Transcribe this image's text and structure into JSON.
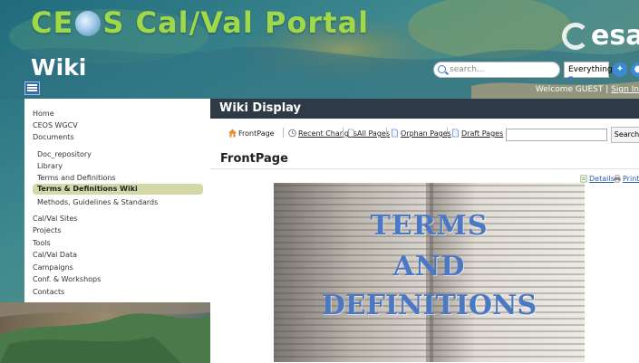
{
  "header": {
    "logo_prefix": "CE",
    "logo_suffix": "S Cal/Val Portal",
    "section_title": "Wiki",
    "partner_logo": "esa",
    "search": {
      "placeholder": "search...",
      "scope": "Everything"
    },
    "social_icons": [
      "twitter-icon",
      "social-icon"
    ],
    "welcome_text": "Welcome GUEST |",
    "sign_in": "Sign In"
  },
  "sidebar": {
    "items": [
      {
        "label": "Home"
      },
      {
        "label": "CEOS WGCV"
      },
      {
        "label": "Documents"
      },
      {
        "label": "Doc_repository"
      },
      {
        "label": "Library"
      },
      {
        "label": "Terms and Definitions"
      },
      {
        "label": "Terms & Definitions Wiki",
        "active": true
      },
      {
        "label": "Methods, Guidelines & Standards"
      },
      {
        "label": "Cal/Val Sites"
      },
      {
        "label": "Projects"
      },
      {
        "label": "Tools"
      },
      {
        "label": "Cal/Val Data"
      },
      {
        "label": "Campaigns"
      },
      {
        "label": "Conf. & Workshops"
      },
      {
        "label": "Contacts"
      }
    ]
  },
  "main": {
    "panel_title": "Wiki Display",
    "toolbar": {
      "front_page": "FrontPage",
      "recent_changes": "Recent Changes",
      "all_pages": "All Pages",
      "orphan_pages": "Orphan Pages",
      "draft_pages": "Draft Pages",
      "search_button": "Search"
    },
    "page_title": "FrontPage",
    "details_link": "Details",
    "print_link": "Print",
    "banner": {
      "line1": "TERMS",
      "line2": "AND",
      "line3": "DEFINITIONS"
    }
  },
  "colors": {
    "logo_green": "#9fd84a",
    "panel_header": "#2e3b47",
    "active_item": "#d4d8a8",
    "link_blue": "#2a5da8"
  }
}
